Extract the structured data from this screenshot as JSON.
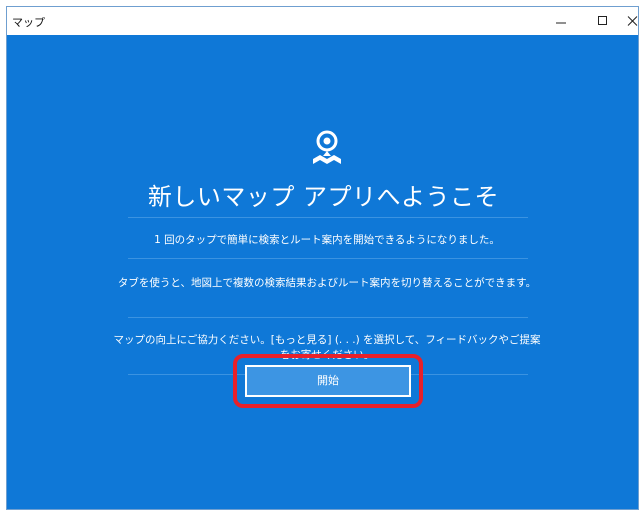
{
  "window": {
    "title": "マップ"
  },
  "welcome": {
    "heading": "新しいマップ アプリへようこそ",
    "messages": [
      "1 回のタップで簡単に検索とルート案内を開始できるようになりました。",
      "タブを使うと、地図上で複数の検索結果およびルート案内を切り替えることができます。",
      "マップの向上にご協力ください。[もっと見る] (. . .) を選択して、フィードバックやご提案をお寄せください。"
    ],
    "start_label": "開始"
  },
  "colors": {
    "background": "#0f78d7",
    "button": "#3d95e3",
    "highlight": "#e8202a"
  },
  "icons": {
    "app_logo": "maps-pin-icon"
  }
}
